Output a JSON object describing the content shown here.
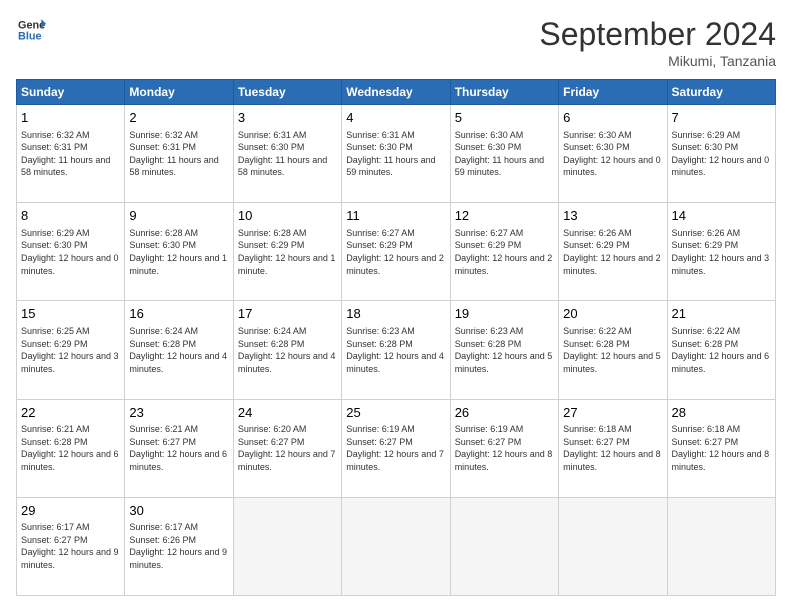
{
  "logo": {
    "line1": "General",
    "line2": "Blue"
  },
  "title": "September 2024",
  "subtitle": "Mikumi, Tanzania",
  "days_of_week": [
    "Sunday",
    "Monday",
    "Tuesday",
    "Wednesday",
    "Thursday",
    "Friday",
    "Saturday"
  ],
  "weeks": [
    [
      {
        "num": "1",
        "sunrise": "Sunrise: 6:32 AM",
        "sunset": "Sunset: 6:31 PM",
        "daylight": "Daylight: 11 hours and 58 minutes."
      },
      {
        "num": "2",
        "sunrise": "Sunrise: 6:32 AM",
        "sunset": "Sunset: 6:31 PM",
        "daylight": "Daylight: 11 hours and 58 minutes."
      },
      {
        "num": "3",
        "sunrise": "Sunrise: 6:31 AM",
        "sunset": "Sunset: 6:30 PM",
        "daylight": "Daylight: 11 hours and 58 minutes."
      },
      {
        "num": "4",
        "sunrise": "Sunrise: 6:31 AM",
        "sunset": "Sunset: 6:30 PM",
        "daylight": "Daylight: 11 hours and 59 minutes."
      },
      {
        "num": "5",
        "sunrise": "Sunrise: 6:30 AM",
        "sunset": "Sunset: 6:30 PM",
        "daylight": "Daylight: 11 hours and 59 minutes."
      },
      {
        "num": "6",
        "sunrise": "Sunrise: 6:30 AM",
        "sunset": "Sunset: 6:30 PM",
        "daylight": "Daylight: 12 hours and 0 minutes."
      },
      {
        "num": "7",
        "sunrise": "Sunrise: 6:29 AM",
        "sunset": "Sunset: 6:30 PM",
        "daylight": "Daylight: 12 hours and 0 minutes."
      }
    ],
    [
      {
        "num": "8",
        "sunrise": "Sunrise: 6:29 AM",
        "sunset": "Sunset: 6:30 PM",
        "daylight": "Daylight: 12 hours and 0 minutes."
      },
      {
        "num": "9",
        "sunrise": "Sunrise: 6:28 AM",
        "sunset": "Sunset: 6:30 PM",
        "daylight": "Daylight: 12 hours and 1 minute."
      },
      {
        "num": "10",
        "sunrise": "Sunrise: 6:28 AM",
        "sunset": "Sunset: 6:29 PM",
        "daylight": "Daylight: 12 hours and 1 minute."
      },
      {
        "num": "11",
        "sunrise": "Sunrise: 6:27 AM",
        "sunset": "Sunset: 6:29 PM",
        "daylight": "Daylight: 12 hours and 2 minutes."
      },
      {
        "num": "12",
        "sunrise": "Sunrise: 6:27 AM",
        "sunset": "Sunset: 6:29 PM",
        "daylight": "Daylight: 12 hours and 2 minutes."
      },
      {
        "num": "13",
        "sunrise": "Sunrise: 6:26 AM",
        "sunset": "Sunset: 6:29 PM",
        "daylight": "Daylight: 12 hours and 2 minutes."
      },
      {
        "num": "14",
        "sunrise": "Sunrise: 6:26 AM",
        "sunset": "Sunset: 6:29 PM",
        "daylight": "Daylight: 12 hours and 3 minutes."
      }
    ],
    [
      {
        "num": "15",
        "sunrise": "Sunrise: 6:25 AM",
        "sunset": "Sunset: 6:29 PM",
        "daylight": "Daylight: 12 hours and 3 minutes."
      },
      {
        "num": "16",
        "sunrise": "Sunrise: 6:24 AM",
        "sunset": "Sunset: 6:28 PM",
        "daylight": "Daylight: 12 hours and 4 minutes."
      },
      {
        "num": "17",
        "sunrise": "Sunrise: 6:24 AM",
        "sunset": "Sunset: 6:28 PM",
        "daylight": "Daylight: 12 hours and 4 minutes."
      },
      {
        "num": "18",
        "sunrise": "Sunrise: 6:23 AM",
        "sunset": "Sunset: 6:28 PM",
        "daylight": "Daylight: 12 hours and 4 minutes."
      },
      {
        "num": "19",
        "sunrise": "Sunrise: 6:23 AM",
        "sunset": "Sunset: 6:28 PM",
        "daylight": "Daylight: 12 hours and 5 minutes."
      },
      {
        "num": "20",
        "sunrise": "Sunrise: 6:22 AM",
        "sunset": "Sunset: 6:28 PM",
        "daylight": "Daylight: 12 hours and 5 minutes."
      },
      {
        "num": "21",
        "sunrise": "Sunrise: 6:22 AM",
        "sunset": "Sunset: 6:28 PM",
        "daylight": "Daylight: 12 hours and 6 minutes."
      }
    ],
    [
      {
        "num": "22",
        "sunrise": "Sunrise: 6:21 AM",
        "sunset": "Sunset: 6:28 PM",
        "daylight": "Daylight: 12 hours and 6 minutes."
      },
      {
        "num": "23",
        "sunrise": "Sunrise: 6:21 AM",
        "sunset": "Sunset: 6:27 PM",
        "daylight": "Daylight: 12 hours and 6 minutes."
      },
      {
        "num": "24",
        "sunrise": "Sunrise: 6:20 AM",
        "sunset": "Sunset: 6:27 PM",
        "daylight": "Daylight: 12 hours and 7 minutes."
      },
      {
        "num": "25",
        "sunrise": "Sunrise: 6:19 AM",
        "sunset": "Sunset: 6:27 PM",
        "daylight": "Daylight: 12 hours and 7 minutes."
      },
      {
        "num": "26",
        "sunrise": "Sunrise: 6:19 AM",
        "sunset": "Sunset: 6:27 PM",
        "daylight": "Daylight: 12 hours and 8 minutes."
      },
      {
        "num": "27",
        "sunrise": "Sunrise: 6:18 AM",
        "sunset": "Sunset: 6:27 PM",
        "daylight": "Daylight: 12 hours and 8 minutes."
      },
      {
        "num": "28",
        "sunrise": "Sunrise: 6:18 AM",
        "sunset": "Sunset: 6:27 PM",
        "daylight": "Daylight: 12 hours and 8 minutes."
      }
    ],
    [
      {
        "num": "29",
        "sunrise": "Sunrise: 6:17 AM",
        "sunset": "Sunset: 6:27 PM",
        "daylight": "Daylight: 12 hours and 9 minutes."
      },
      {
        "num": "30",
        "sunrise": "Sunrise: 6:17 AM",
        "sunset": "Sunset: 6:26 PM",
        "daylight": "Daylight: 12 hours and 9 minutes."
      },
      {
        "num": "",
        "sunrise": "",
        "sunset": "",
        "daylight": ""
      },
      {
        "num": "",
        "sunrise": "",
        "sunset": "",
        "daylight": ""
      },
      {
        "num": "",
        "sunrise": "",
        "sunset": "",
        "daylight": ""
      },
      {
        "num": "",
        "sunrise": "",
        "sunset": "",
        "daylight": ""
      },
      {
        "num": "",
        "sunrise": "",
        "sunset": "",
        "daylight": ""
      }
    ]
  ]
}
